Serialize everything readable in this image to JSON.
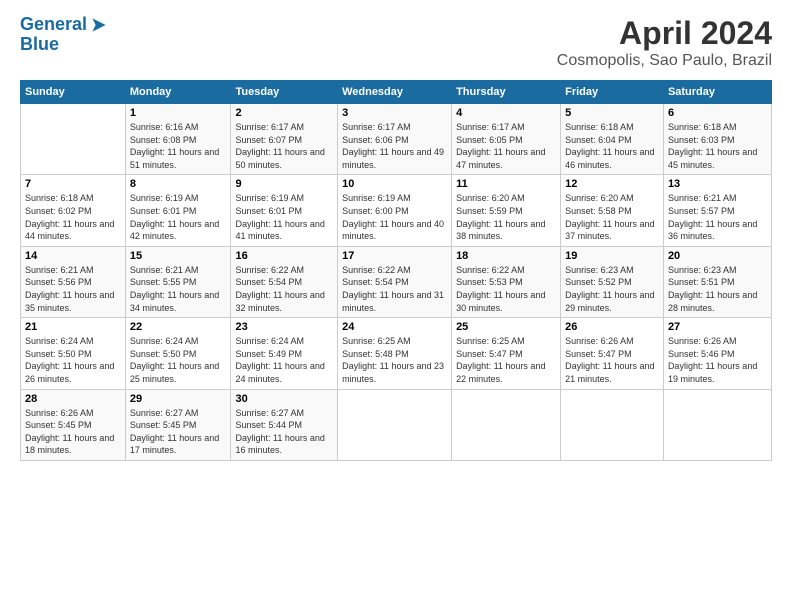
{
  "logo": {
    "line1": "General",
    "line2": "Blue"
  },
  "title": "April 2024",
  "subtitle": "Cosmopolis, Sao Paulo, Brazil",
  "days_of_week": [
    "Sunday",
    "Monday",
    "Tuesday",
    "Wednesday",
    "Thursday",
    "Friday",
    "Saturday"
  ],
  "weeks": [
    [
      {
        "day": "",
        "sunrise": "",
        "sunset": "",
        "daylight": ""
      },
      {
        "day": "1",
        "sunrise": "Sunrise: 6:16 AM",
        "sunset": "Sunset: 6:08 PM",
        "daylight": "Daylight: 11 hours and 51 minutes."
      },
      {
        "day": "2",
        "sunrise": "Sunrise: 6:17 AM",
        "sunset": "Sunset: 6:07 PM",
        "daylight": "Daylight: 11 hours and 50 minutes."
      },
      {
        "day": "3",
        "sunrise": "Sunrise: 6:17 AM",
        "sunset": "Sunset: 6:06 PM",
        "daylight": "Daylight: 11 hours and 49 minutes."
      },
      {
        "day": "4",
        "sunrise": "Sunrise: 6:17 AM",
        "sunset": "Sunset: 6:05 PM",
        "daylight": "Daylight: 11 hours and 47 minutes."
      },
      {
        "day": "5",
        "sunrise": "Sunrise: 6:18 AM",
        "sunset": "Sunset: 6:04 PM",
        "daylight": "Daylight: 11 hours and 46 minutes."
      },
      {
        "day": "6",
        "sunrise": "Sunrise: 6:18 AM",
        "sunset": "Sunset: 6:03 PM",
        "daylight": "Daylight: 11 hours and 45 minutes."
      }
    ],
    [
      {
        "day": "7",
        "sunrise": "Sunrise: 6:18 AM",
        "sunset": "Sunset: 6:02 PM",
        "daylight": "Daylight: 11 hours and 44 minutes."
      },
      {
        "day": "8",
        "sunrise": "Sunrise: 6:19 AM",
        "sunset": "Sunset: 6:01 PM",
        "daylight": "Daylight: 11 hours and 42 minutes."
      },
      {
        "day": "9",
        "sunrise": "Sunrise: 6:19 AM",
        "sunset": "Sunset: 6:01 PM",
        "daylight": "Daylight: 11 hours and 41 minutes."
      },
      {
        "day": "10",
        "sunrise": "Sunrise: 6:19 AM",
        "sunset": "Sunset: 6:00 PM",
        "daylight": "Daylight: 11 hours and 40 minutes."
      },
      {
        "day": "11",
        "sunrise": "Sunrise: 6:20 AM",
        "sunset": "Sunset: 5:59 PM",
        "daylight": "Daylight: 11 hours and 38 minutes."
      },
      {
        "day": "12",
        "sunrise": "Sunrise: 6:20 AM",
        "sunset": "Sunset: 5:58 PM",
        "daylight": "Daylight: 11 hours and 37 minutes."
      },
      {
        "day": "13",
        "sunrise": "Sunrise: 6:21 AM",
        "sunset": "Sunset: 5:57 PM",
        "daylight": "Daylight: 11 hours and 36 minutes."
      }
    ],
    [
      {
        "day": "14",
        "sunrise": "Sunrise: 6:21 AM",
        "sunset": "Sunset: 5:56 PM",
        "daylight": "Daylight: 11 hours and 35 minutes."
      },
      {
        "day": "15",
        "sunrise": "Sunrise: 6:21 AM",
        "sunset": "Sunset: 5:55 PM",
        "daylight": "Daylight: 11 hours and 34 minutes."
      },
      {
        "day": "16",
        "sunrise": "Sunrise: 6:22 AM",
        "sunset": "Sunset: 5:54 PM",
        "daylight": "Daylight: 11 hours and 32 minutes."
      },
      {
        "day": "17",
        "sunrise": "Sunrise: 6:22 AM",
        "sunset": "Sunset: 5:54 PM",
        "daylight": "Daylight: 11 hours and 31 minutes."
      },
      {
        "day": "18",
        "sunrise": "Sunrise: 6:22 AM",
        "sunset": "Sunset: 5:53 PM",
        "daylight": "Daylight: 11 hours and 30 minutes."
      },
      {
        "day": "19",
        "sunrise": "Sunrise: 6:23 AM",
        "sunset": "Sunset: 5:52 PM",
        "daylight": "Daylight: 11 hours and 29 minutes."
      },
      {
        "day": "20",
        "sunrise": "Sunrise: 6:23 AM",
        "sunset": "Sunset: 5:51 PM",
        "daylight": "Daylight: 11 hours and 28 minutes."
      }
    ],
    [
      {
        "day": "21",
        "sunrise": "Sunrise: 6:24 AM",
        "sunset": "Sunset: 5:50 PM",
        "daylight": "Daylight: 11 hours and 26 minutes."
      },
      {
        "day": "22",
        "sunrise": "Sunrise: 6:24 AM",
        "sunset": "Sunset: 5:50 PM",
        "daylight": "Daylight: 11 hours and 25 minutes."
      },
      {
        "day": "23",
        "sunrise": "Sunrise: 6:24 AM",
        "sunset": "Sunset: 5:49 PM",
        "daylight": "Daylight: 11 hours and 24 minutes."
      },
      {
        "day": "24",
        "sunrise": "Sunrise: 6:25 AM",
        "sunset": "Sunset: 5:48 PM",
        "daylight": "Daylight: 11 hours and 23 minutes."
      },
      {
        "day": "25",
        "sunrise": "Sunrise: 6:25 AM",
        "sunset": "Sunset: 5:47 PM",
        "daylight": "Daylight: 11 hours and 22 minutes."
      },
      {
        "day": "26",
        "sunrise": "Sunrise: 6:26 AM",
        "sunset": "Sunset: 5:47 PM",
        "daylight": "Daylight: 11 hours and 21 minutes."
      },
      {
        "day": "27",
        "sunrise": "Sunrise: 6:26 AM",
        "sunset": "Sunset: 5:46 PM",
        "daylight": "Daylight: 11 hours and 19 minutes."
      }
    ],
    [
      {
        "day": "28",
        "sunrise": "Sunrise: 6:26 AM",
        "sunset": "Sunset: 5:45 PM",
        "daylight": "Daylight: 11 hours and 18 minutes."
      },
      {
        "day": "29",
        "sunrise": "Sunrise: 6:27 AM",
        "sunset": "Sunset: 5:45 PM",
        "daylight": "Daylight: 11 hours and 17 minutes."
      },
      {
        "day": "30",
        "sunrise": "Sunrise: 6:27 AM",
        "sunset": "Sunset: 5:44 PM",
        "daylight": "Daylight: 11 hours and 16 minutes."
      },
      {
        "day": "",
        "sunrise": "",
        "sunset": "",
        "daylight": ""
      },
      {
        "day": "",
        "sunrise": "",
        "sunset": "",
        "daylight": ""
      },
      {
        "day": "",
        "sunrise": "",
        "sunset": "",
        "daylight": ""
      },
      {
        "day": "",
        "sunrise": "",
        "sunset": "",
        "daylight": ""
      }
    ]
  ]
}
